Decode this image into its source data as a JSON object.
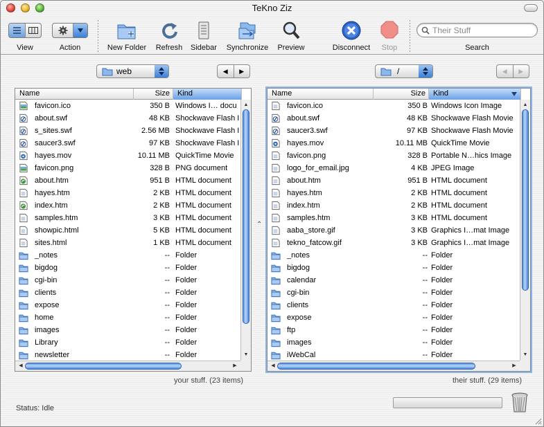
{
  "window": {
    "title": "TeKno Ziz"
  },
  "toolbar": {
    "view_label": "View",
    "action_label": "Action",
    "new_folder_label": "New Folder",
    "refresh_label": "Refresh",
    "sidebar_label": "Sidebar",
    "synchronize_label": "Synchronize",
    "preview_label": "Preview",
    "disconnect_label": "Disconnect",
    "stop_label": "Stop",
    "search_label": "Search",
    "search_placeholder": "Their Stuff"
  },
  "left": {
    "path": "web",
    "col_name": "Name",
    "col_size": "Size",
    "col_kind": "Kind",
    "info": "your stuff. (23 items)",
    "files": [
      {
        "name": "favicon.ico",
        "size": "350 B",
        "kind": "Windows I… docu",
        "icon": "image-file-icon"
      },
      {
        "name": "about.swf",
        "size": "48 KB",
        "kind": "Shockwave Flash I",
        "icon": "flash-file-icon"
      },
      {
        "name": "s_sites.swf",
        "size": "2.56 MB",
        "kind": "Shockwave Flash I",
        "icon": "flash-file-icon"
      },
      {
        "name": "saucer3.swf",
        "size": "97 KB",
        "kind": "Shockwave Flash I",
        "icon": "flash-file-icon"
      },
      {
        "name": "hayes.mov",
        "size": "10.11 MB",
        "kind": "QuickTime Movie",
        "icon": "movie-file-icon"
      },
      {
        "name": "favicon.png",
        "size": "328 B",
        "kind": "PNG document",
        "icon": "image-file-icon"
      },
      {
        "name": "about.htm",
        "size": "951 B",
        "kind": "HTML document",
        "icon": "html-file-icon"
      },
      {
        "name": "hayes.htm",
        "size": "2 KB",
        "kind": "HTML document",
        "icon": "document-file-icon"
      },
      {
        "name": "index.htm",
        "size": "2 KB",
        "kind": "HTML document",
        "icon": "html-file-icon"
      },
      {
        "name": "samples.htm",
        "size": "3 KB",
        "kind": "HTML document",
        "icon": "document-file-icon"
      },
      {
        "name": "showpic.html",
        "size": "5 KB",
        "kind": "HTML document",
        "icon": "document-file-icon"
      },
      {
        "name": "sites.html",
        "size": "1 KB",
        "kind": "HTML document",
        "icon": "document-file-icon"
      },
      {
        "name": "_notes",
        "size": "--",
        "kind": "Folder",
        "icon": "folder-icon"
      },
      {
        "name": "bigdog",
        "size": "--",
        "kind": "Folder",
        "icon": "folder-icon"
      },
      {
        "name": "cgi-bin",
        "size": "--",
        "kind": "Folder",
        "icon": "folder-icon"
      },
      {
        "name": "clients",
        "size": "--",
        "kind": "Folder",
        "icon": "folder-icon"
      },
      {
        "name": "expose",
        "size": "--",
        "kind": "Folder",
        "icon": "folder-icon"
      },
      {
        "name": "home",
        "size": "--",
        "kind": "Folder",
        "icon": "folder-icon"
      },
      {
        "name": "images",
        "size": "--",
        "kind": "Folder",
        "icon": "folder-icon"
      },
      {
        "name": "Library",
        "size": "--",
        "kind": "Folder",
        "icon": "folder-icon"
      },
      {
        "name": "newsletter",
        "size": "--",
        "kind": "Folder",
        "icon": "folder-icon"
      }
    ]
  },
  "right": {
    "path": "/",
    "col_name": "Name",
    "col_size": "Size",
    "col_kind": "Kind",
    "info": "their stuff. (29 items)",
    "files": [
      {
        "name": "favicon.ico",
        "size": "350 B",
        "kind": "Windows Icon Image",
        "icon": "document-file-icon"
      },
      {
        "name": "about.swf",
        "size": "48 KB",
        "kind": "Shockwave Flash Movie",
        "icon": "flash-file-icon"
      },
      {
        "name": "saucer3.swf",
        "size": "97 KB",
        "kind": "Shockwave Flash Movie",
        "icon": "flash-file-icon"
      },
      {
        "name": "hayes.mov",
        "size": "10.11 MB",
        "kind": "QuickTime Movie",
        "icon": "movie-file-icon"
      },
      {
        "name": "favicon.png",
        "size": "328 B",
        "kind": "Portable N…hics Image",
        "icon": "document-file-icon"
      },
      {
        "name": "logo_for_email.jpg",
        "size": "4 KB",
        "kind": "JPEG Image",
        "icon": "document-file-icon"
      },
      {
        "name": "about.htm",
        "size": "951 B",
        "kind": "HTML document",
        "icon": "document-file-icon"
      },
      {
        "name": "hayes.htm",
        "size": "2 KB",
        "kind": "HTML document",
        "icon": "document-file-icon"
      },
      {
        "name": "index.htm",
        "size": "2 KB",
        "kind": "HTML document",
        "icon": "document-file-icon"
      },
      {
        "name": "samples.htm",
        "size": "3 KB",
        "kind": "HTML document",
        "icon": "document-file-icon"
      },
      {
        "name": "aaba_store.gif",
        "size": "3 KB",
        "kind": "Graphics I…mat Image",
        "icon": "document-file-icon"
      },
      {
        "name": "tekno_fatcow.gif",
        "size": "3 KB",
        "kind": "Graphics I…mat Image",
        "icon": "document-file-icon"
      },
      {
        "name": "_notes",
        "size": "--",
        "kind": "Folder",
        "icon": "folder-icon"
      },
      {
        "name": "bigdog",
        "size": "--",
        "kind": "Folder",
        "icon": "folder-icon"
      },
      {
        "name": "calendar",
        "size": "--",
        "kind": "Folder",
        "icon": "folder-icon"
      },
      {
        "name": "cgi-bin",
        "size": "--",
        "kind": "Folder",
        "icon": "folder-icon"
      },
      {
        "name": "clients",
        "size": "--",
        "kind": "Folder",
        "icon": "folder-icon"
      },
      {
        "name": "expose",
        "size": "--",
        "kind": "Folder",
        "icon": "folder-icon"
      },
      {
        "name": "ftp",
        "size": "--",
        "kind": "Folder",
        "icon": "folder-icon"
      },
      {
        "name": "images",
        "size": "--",
        "kind": "Folder",
        "icon": "folder-icon"
      },
      {
        "name": "iWebCal",
        "size": "--",
        "kind": "Folder",
        "icon": "folder-icon"
      }
    ]
  },
  "status": {
    "text": "Status: Idle"
  },
  "colors": {
    "accent": "#3e7fd6",
    "selection_header": "#6aa1e6",
    "folder": "#8db8ec"
  }
}
